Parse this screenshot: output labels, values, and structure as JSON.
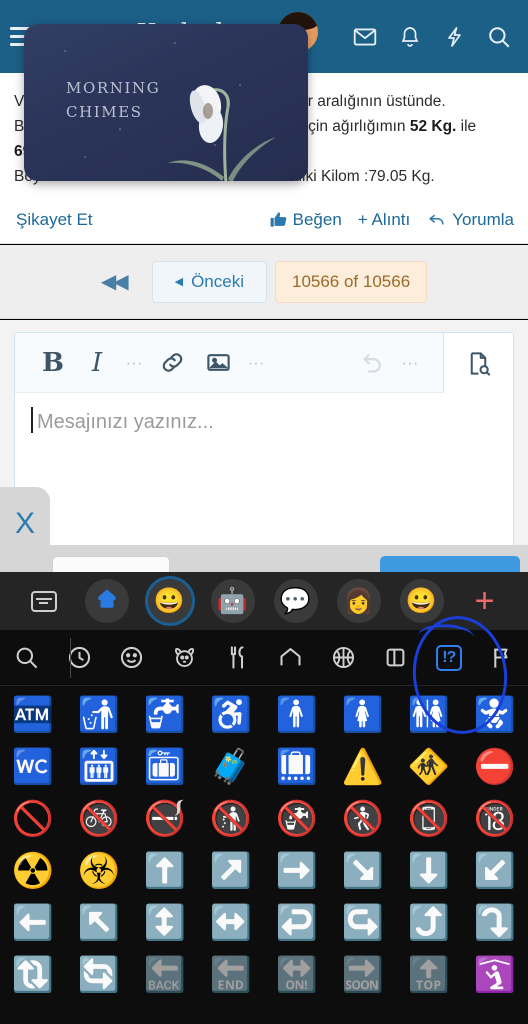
{
  "appbar": {
    "logo_text": "Kadınlar",
    "icons": [
      {
        "name": "mail-icon",
        "label": "Mesajlar"
      },
      {
        "name": "bell-icon",
        "label": "Bildirimler"
      },
      {
        "name": "lightning-icon",
        "label": "Aktivite"
      },
      {
        "name": "search-icon",
        "label": "Ara"
      }
    ],
    "hamburger_label": "Menü",
    "bg_color": "#1c6088"
  },
  "post": {
    "line1_left": "Vü",
    "line1_right": "değer aralığının üstünde.",
    "line2_left": "Bo",
    "line2_right_a": "nam için ağırlığımın ",
    "line2_bold": "52 Kg.",
    "line2_right_b": " ile",
    "line3_left": "69",
    "line4_left": "Boy",
    "line4_right": "imdiki Kilom :79.05 Kg."
  },
  "actionbar": {
    "report": "Şikayet Et",
    "like": "Beğen",
    "quote": "+ Alıntı",
    "comment": "Yorumla",
    "link_color": "#1d6a99"
  },
  "pagination": {
    "first_label": "◀◀",
    "prev_label": "Önceki",
    "prev_caret": "◀",
    "count_label": "10566 of 10566",
    "current_page": 10566,
    "total_pages": 10566,
    "count_bg": "#fdeedb",
    "count_color": "#9a6a2a"
  },
  "editor": {
    "toolbar": [
      {
        "name": "bold-button",
        "label": "B"
      },
      {
        "name": "italic-button",
        "label": "I"
      },
      {
        "name": "overflow-dots-1",
        "label": "⋮"
      },
      {
        "name": "link-button",
        "label": "link"
      },
      {
        "name": "image-button",
        "label": "image"
      },
      {
        "name": "overflow-dots-2",
        "label": "⋮"
      },
      {
        "name": "undo-button",
        "label": "undo"
      },
      {
        "name": "overflow-dots-3",
        "label": "⋮"
      },
      {
        "name": "preview-button",
        "label": "preview"
      }
    ],
    "placeholder": "Mesajınızı yazınız...",
    "value": "",
    "close_tab_label": "X"
  },
  "keyboard": {
    "apps_row": [
      {
        "name": "keyboard-switch-icon",
        "glyph": ""
      },
      {
        "name": "gboard-home-icon",
        "glyph": ""
      },
      {
        "name": "emoji-tab-icon",
        "glyph": "😀",
        "selected": true
      },
      {
        "name": "gif-sticker-icon",
        "glyph": "🤖"
      },
      {
        "name": "sticker-icon",
        "glyph": "💬"
      },
      {
        "name": "avatar-sticker-icon",
        "glyph": "👩"
      },
      {
        "name": "emoji-kitchen-icon",
        "glyph": "😀"
      },
      {
        "name": "add-app-icon",
        "glyph": "+"
      }
    ],
    "categories": [
      {
        "name": "category-search-icon",
        "label": "Ara"
      },
      {
        "name": "category-recent-icon",
        "label": "Son kullanılanlar"
      },
      {
        "name": "category-smileys-icon",
        "label": "İfadeler"
      },
      {
        "name": "category-animals-icon",
        "label": "Hayvanlar"
      },
      {
        "name": "category-food-icon",
        "label": "Yiyecek"
      },
      {
        "name": "category-travel-icon",
        "label": "Seyahat"
      },
      {
        "name": "category-activity-icon",
        "label": "Aktivite"
      },
      {
        "name": "category-objects-icon",
        "label": "Nesneler"
      },
      {
        "name": "category-symbols-icon",
        "label": "Semboller",
        "selected": true
      },
      {
        "name": "category-flags-icon",
        "label": "Bayraklar"
      }
    ],
    "selected_category": "Semboller",
    "symbols_label": "!?",
    "emoji_rows": [
      [
        "🏧",
        "🚮",
        "🚰",
        "♿",
        "🚹",
        "🚺",
        "🚻",
        "🚼"
      ],
      [
        "🚾",
        "🛗",
        "🛅",
        "🧳",
        "🛄",
        "⚠️",
        "🚸",
        "⛔"
      ],
      [
        "🚫",
        "🚳",
        "🚭",
        "🚯",
        "🚱",
        "🚷",
        "📵",
        "🔞"
      ],
      [
        "☢️",
        "☣️",
        "⬆️",
        "↗️",
        "➡️",
        "↘️",
        "⬇️",
        "↙️"
      ],
      [
        "⬅️",
        "↖️",
        "↕️",
        "↔️",
        "↩️",
        "↪️",
        "⤴️",
        "⤵️"
      ],
      [
        "🔃",
        "🔄",
        "🔙",
        "🔚",
        "🔛",
        "🔜",
        "🔝",
        "🛐"
      ]
    ]
  },
  "overlay_card": {
    "title_line1": "Morning",
    "title_line2": "Chimes",
    "bg_color": "#2b355a"
  },
  "annotation": {
    "name": "highlight-circle",
    "color": "#1a3fd6",
    "targets": "category-symbols-icon"
  }
}
